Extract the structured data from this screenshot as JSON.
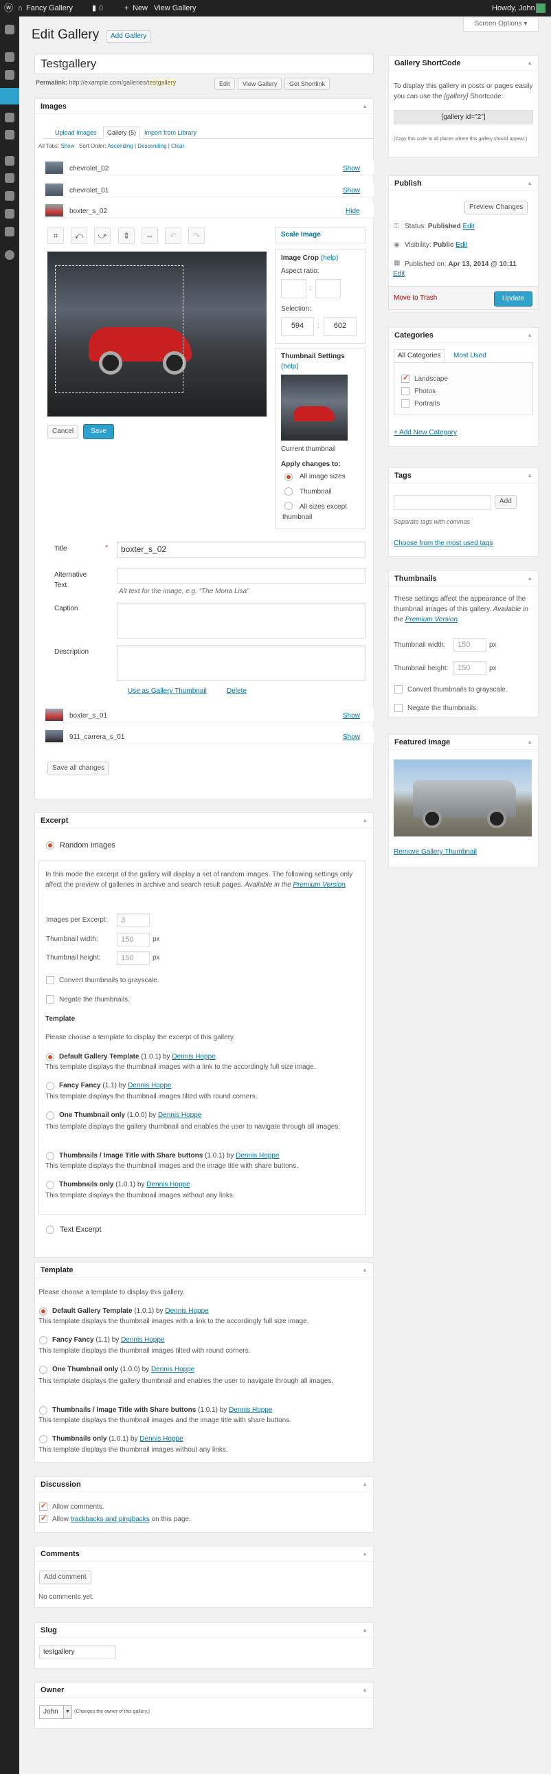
{
  "adminbar": {
    "site": "Fancy Gallery",
    "comments": "0",
    "new": "New",
    "view": "View Gallery",
    "howdy": "Howdy, John"
  },
  "screen_options": "Screen Options",
  "page": {
    "title": "Edit Gallery",
    "add_button": "Add Gallery"
  },
  "post": {
    "title": "Testgallery",
    "permalink_label": "Permalink:",
    "permalink_base": "http://example.com/galleries/",
    "permalink_slug": "testgallery",
    "edit": "Edit",
    "view": "View Gallery",
    "shortlink": "Get Shortlink"
  },
  "images": {
    "heading": "Images",
    "tabs": [
      "Upload Images",
      "Gallery (5)",
      "Import from Library"
    ],
    "all_tabs": "All Tabs:",
    "show": "Show",
    "sort_order": "Sort Order:",
    "ascending": "Ascending",
    "descending": "Descending",
    "clear": "Clear",
    "items_top": [
      {
        "name": "chevrolet_02",
        "action": "Show"
      },
      {
        "name": "chevrolet_01",
        "action": "Show"
      },
      {
        "name": "boxter_s_02",
        "action": "Hide"
      }
    ],
    "scale_image": "Scale Image",
    "crop_label": "Image Crop",
    "help": "(help)",
    "aspect_ratio": "Aspect ratio:",
    "selection": "Selection:",
    "sel_w": "594",
    "sel_h": "602",
    "thumb_settings": "Thumbnail Settings",
    "current_thumb": "Current thumbnail",
    "apply_changes": "Apply changes to:",
    "apply_options": [
      "All image sizes",
      "Thumbnail",
      "All sizes except thumbnail"
    ],
    "cancel": "Cancel",
    "save": "Save",
    "title_label": "Title",
    "title_value": "boxter_s_02",
    "alt_label": "Alternative Text",
    "alt_help": "Alt text for the image, e.g. “The Mona Lisa”",
    "caption_label": "Caption",
    "description_label": "Description",
    "use_thumb": "Use as Gallery Thumbnail",
    "delete": "Delete",
    "items_bottom": [
      {
        "name": "boxter_s_01",
        "action": "Show"
      },
      {
        "name": "911_carrera_s_01",
        "action": "Show"
      }
    ],
    "save_all": "Save all changes"
  },
  "excerpt": {
    "heading": "Excerpt",
    "random": "Random Images",
    "intro": "In this mode the excerpt of the gallery will display a set of random images. The following settings only affect the preview of galleries in archive and search result pages.",
    "available": "Available in the",
    "premium": "Premium Version",
    "per_excerpt": "Images per Excerpt:",
    "per_excerpt_val": "3",
    "thumb_w": "Thumbnail width:",
    "thumb_w_val": "150",
    "thumb_h": "Thumbnail height:",
    "thumb_h_val": "150",
    "px": "px",
    "grayscale": "Convert thumbnails to grayscale.",
    "negate": "Negate the thumbnails.",
    "template_heading": "Template",
    "template_intro": "Please choose a template to display the excerpt of this gallery.",
    "text_excerpt": "Text Excerpt"
  },
  "templates": [
    {
      "name": "Default Gallery Template",
      "version": "(1.0.1) by",
      "author": "Dennis Hoppe",
      "desc": "This template displays the thumbnail images with a link to the accordingly full size image."
    },
    {
      "name": "Fancy Fancy",
      "version": "(1.1) by",
      "author": "Dennis Hoppe",
      "desc": "This template displays the thumbnail images tilted with round corners."
    },
    {
      "name": "One Thumbnail only",
      "version": "(1.0.0) by",
      "author": "Dennis Hoppe",
      "desc": "This template displays the gallery thumbnail and enables the user to navigate through all images."
    },
    {
      "name": "Thumbnails / Image Title with Share buttons",
      "version": "(1.0.1) by",
      "author": "Dennis Hoppe",
      "desc": "This template displays the thumbnail images and the image title with share buttons."
    },
    {
      "name": "Thumbnails only",
      "version": "(1.0.1) by",
      "author": "Dennis Hoppe",
      "desc": "This template displays the thumbnail images without any links."
    }
  ],
  "template_box": {
    "heading": "Template",
    "intro": "Please choose a template to display this gallery."
  },
  "discussion": {
    "heading": "Discussion",
    "allow_comments": "Allow comments.",
    "allow": "Allow",
    "trackbacks": "trackbacks and pingbacks",
    "on_page": "on this page."
  },
  "comments": {
    "heading": "Comments",
    "add": "Add comment",
    "none": "No comments yet."
  },
  "slug": {
    "heading": "Slug",
    "value": "testgallery"
  },
  "owner": {
    "heading": "Owner",
    "value": "John",
    "note": "(Changes the owner of this gallery.)"
  },
  "shortcode": {
    "heading": "Gallery ShortCode",
    "text1": "To display this gallery in posts or pages easily you can use the",
    "em": "[gallery]",
    "text2": "Shortcode:",
    "code": "[gallery id=\"2\"]",
    "note": "(Copy this code to all places where this gallery should appear.)"
  },
  "publish": {
    "heading": "Publish",
    "preview": "Preview Changes",
    "status": "Status:",
    "status_val": "Published",
    "visibility": "Visibility:",
    "visibility_val": "Public",
    "published_on": "Published on:",
    "date": "Apr 13, 2014 @ 10:11",
    "edit": "Edit",
    "trash": "Move to Trash",
    "update": "Update"
  },
  "categories": {
    "heading": "Categories",
    "tab_all": "All Categories",
    "tab_used": "Most Used",
    "items": [
      "Landscape",
      "Photos",
      "Portraits"
    ],
    "add_new": "+ Add New Category"
  },
  "tags": {
    "heading": "Tags",
    "add": "Add",
    "hint": "Separate tags with commas",
    "choose": "Choose from the most used tags"
  },
  "thumbnails": {
    "heading": "Thumbnails",
    "text": "These settings affect the appearance of the thumbnail images of this gallery.",
    "available": "Available in the",
    "premium": "Premium Version",
    "w": "Thumbnail width:",
    "w_val": "150",
    "h": "Thumbnail height:",
    "h_val": "150",
    "px": "px",
    "grayscale": "Convert thumbnails to grayscale.",
    "negate": "Negate the thumbnails."
  },
  "featured": {
    "heading": "Featured Image",
    "remove": "Remove Gallery Thumbnail"
  }
}
